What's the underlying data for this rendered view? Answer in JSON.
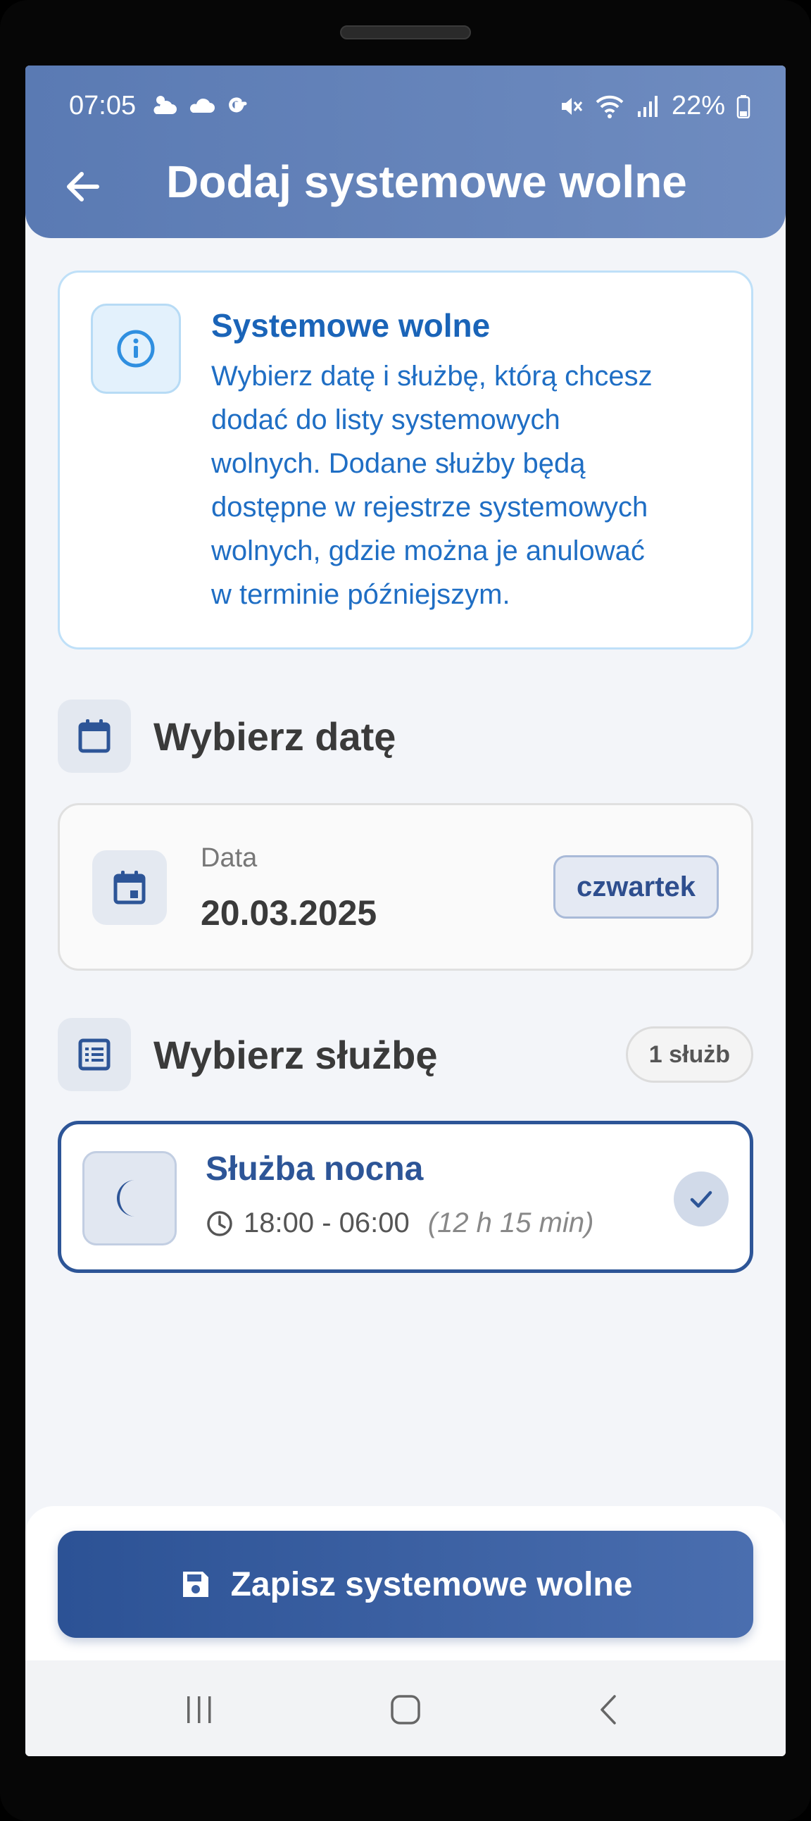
{
  "status_bar": {
    "time": "07:05",
    "battery": "22%",
    "left_icons": [
      "weather-icon",
      "cloud-icon",
      "google-icon"
    ],
    "right_icons": [
      "mute-icon",
      "wifi-icon",
      "signal-icon",
      "battery-icon"
    ]
  },
  "header": {
    "title": "Dodaj systemowe wolne",
    "back_icon": "arrow-left-icon"
  },
  "info": {
    "title": "Systemowe wolne",
    "lines": [
      "Wybierz datę i służbę, którą chcesz",
      "dodać do listy systemowych",
      "wolnych. Dodane służby będą",
      "dostępne w rejestrze systemowych",
      "wolnych, gdzie można je anulować",
      "w terminie późniejszym."
    ],
    "icon": "info-icon"
  },
  "date_section": {
    "title": "Wybierz datę",
    "icon": "calendar-icon",
    "card": {
      "label": "Data",
      "value": "20.03.2025",
      "day": "czwartek",
      "icon": "event-icon"
    }
  },
  "shift_section": {
    "title": "Wybierz służbę",
    "icon": "list-icon",
    "count": "1 służb",
    "shifts": [
      {
        "name": "Służba nocna",
        "time": "18:00 - 06:00",
        "duration": "(12 h 15 min)",
        "icon": "moon-icon",
        "selected": true
      }
    ]
  },
  "actions": {
    "save_label": "Zapisz systemowe wolne",
    "save_icon": "save-icon"
  },
  "nav": {
    "buttons": [
      "recents-icon",
      "home-icon",
      "back-icon"
    ]
  },
  "colors": {
    "header": "#5a7ab3",
    "primary": "#2d5597",
    "info_blue": "#1a64b8",
    "background": "#f3f5f9"
  }
}
